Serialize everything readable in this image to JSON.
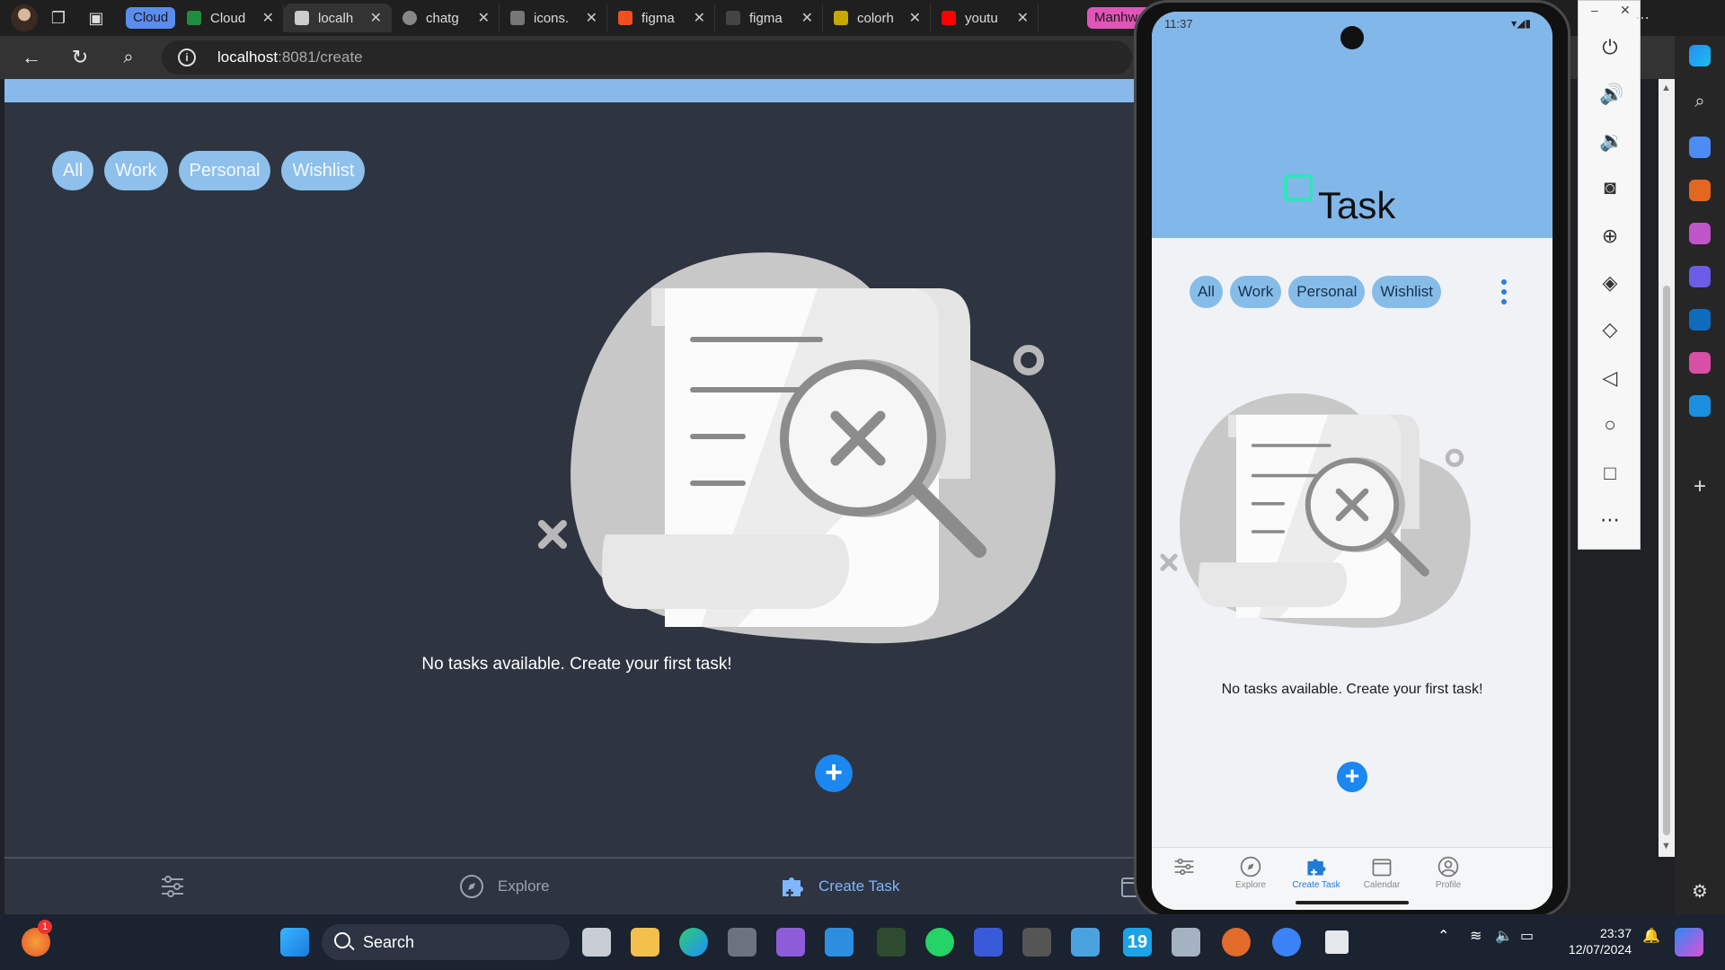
{
  "browser": {
    "tab_group_label": "Cloud",
    "tab_group_color": "#5b8def",
    "tab_group2_label": "Manhwa",
    "tab_group2_color": "#e055b8",
    "tabs": [
      {
        "title": "Cloud",
        "fav": "#1e8e3e"
      },
      {
        "title": "localh",
        "fav": "#cccccc"
      },
      {
        "title": "chatg",
        "fav": "#888888"
      },
      {
        "title": "icons.",
        "fav": "#777777"
      },
      {
        "title": "figma",
        "fav": "#f24e1e"
      },
      {
        "title": "figma",
        "fav": "#444444"
      },
      {
        "title": "colorh",
        "fav": "#c8a800"
      },
      {
        "title": "youtu",
        "fav": "#ff0000"
      }
    ],
    "url_host": "localhost",
    "url_path": ":8081/create"
  },
  "webapp": {
    "chips": [
      "All",
      "Work",
      "Personal",
      "Wishlist"
    ],
    "empty_message": "No tasks available. Create your first task!",
    "fab_label": "+",
    "bottom_nav": {
      "explore": "Explore",
      "create": "Create Task"
    }
  },
  "phone": {
    "status_time": "11:37",
    "app_title": "Task",
    "chips": [
      "All",
      "Work",
      "Personal",
      "Wishlist"
    ],
    "empty_message": "No tasks available. Create your first task!",
    "fab_label": "+",
    "tabs": {
      "explore": "Explore",
      "create": "Create Task",
      "calendar": "Calendar",
      "profile": "Profile"
    }
  },
  "taskbar": {
    "search_label": "Search",
    "time": "23:37",
    "date": "12/07/2024",
    "notification_count": "1",
    "app_19_label": "19"
  }
}
